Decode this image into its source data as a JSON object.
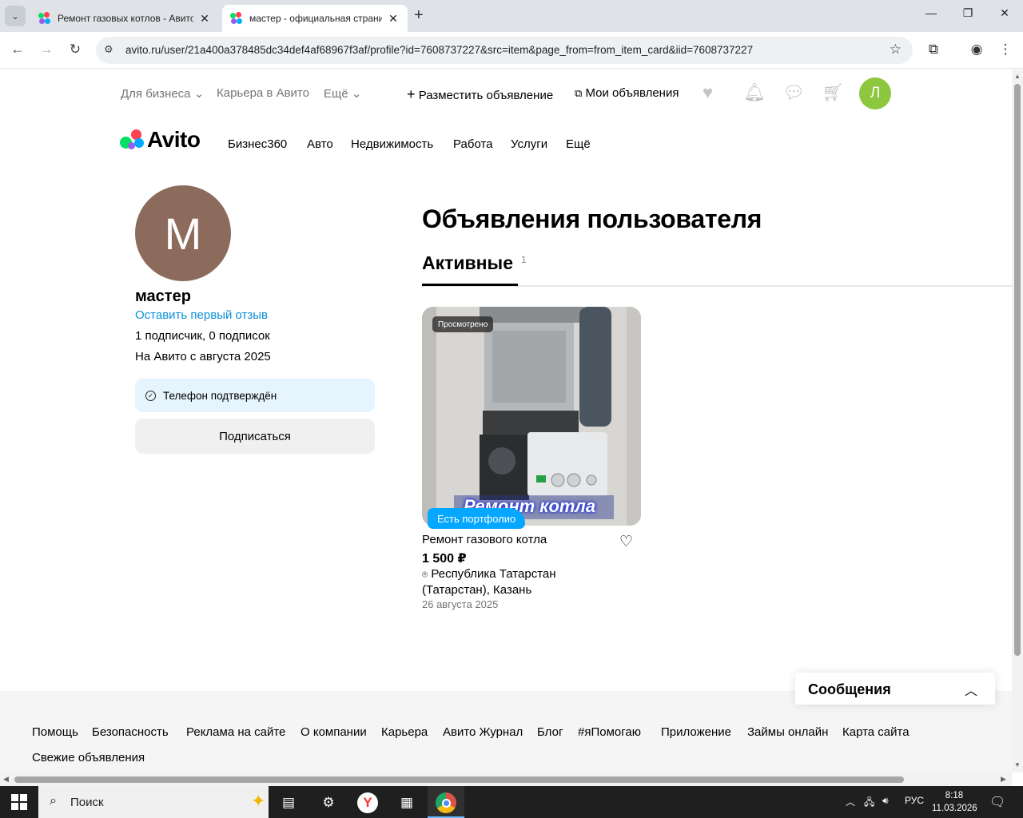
{
  "browser": {
    "tabs": [
      {
        "title": "Ремонт газовых котлов - Авито",
        "active": false
      },
      {
        "title": "мастер - официальная страница",
        "active": true
      }
    ],
    "url": "avito.ru/user/21a400a378485dc34def4af68967f3af/profile?id=7608737227&src=item&page_from=from_item_card&iid=7608737227"
  },
  "header": {
    "for_business": "Для бизнеса",
    "career": "Карьера в Авито",
    "more": "Ещё",
    "post_ad": "Разместить объявление",
    "my_ads": "Мои объявления",
    "avatar_letter": "Л",
    "avatar_color": "#8dc63f"
  },
  "logo": {
    "text": "Avito"
  },
  "categories": [
    "Бизнес360",
    "Авто",
    "Недвижимость",
    "Работа",
    "Услуги",
    "Ещё"
  ],
  "profile": {
    "avatar_letter": "M",
    "avatar_color": "#8d6b5c",
    "name": "мастер",
    "review_link": "Оставить первый отзыв",
    "subscribers": "1 подписчик, 0 подписок",
    "since": "На Авито с августа 2025",
    "phone_verified": "Телефон подтверждён",
    "subscribe_button": "Подписаться"
  },
  "listings": {
    "heading": "Объявления пользователя",
    "tab_active_label": "Активные",
    "tab_active_count": "1",
    "items": [
      {
        "seen_badge": "Просмотрено",
        "image_overlay_text": "Ремонт котла",
        "portfolio_badge": "Есть портфолио",
        "title": "Ремонт газового котла",
        "price": "1 500 ₽",
        "location": "Республика Татарстан (Татарстан), Казань",
        "date": "26 августа 2025"
      }
    ]
  },
  "footer": {
    "links": [
      "Помощь",
      "Безопасность",
      "Реклама на сайте",
      "О компании",
      "Карьера",
      "Авито Журнал",
      "Блог",
      "#яПомогаю",
      "Приложение",
      "Займы онлайн",
      "Карта сайта",
      "Свежие объявления"
    ]
  },
  "messages_widget": {
    "title": "Сообщения"
  },
  "taskbar": {
    "search_label": "Поиск",
    "lang": "РУС",
    "time": "8:18",
    "date": "11.03.2026"
  },
  "colors": {
    "link_blue": "#0a8fda",
    "badge_blue": "#06a7ff",
    "verified_bg": "#e5f4fd"
  }
}
